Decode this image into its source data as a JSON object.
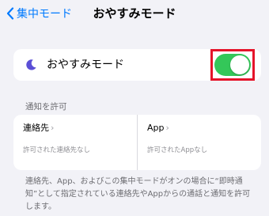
{
  "nav": {
    "back_label": "集中モード",
    "title": "おやすみモード"
  },
  "focus_row": {
    "icon": "moon-icon",
    "label": "おやすみモード",
    "toggle_on": true,
    "toggle_color": "#34c759"
  },
  "allow": {
    "header": "通知を許可",
    "people": {
      "title": "連絡先",
      "subtitle": "許可された連絡先なし"
    },
    "apps": {
      "title": "App",
      "subtitle": "許可されたAppなし"
    }
  },
  "footer": "連絡先、App、およびこの集中モードがオンの場合に“即時通知”として指定されている連絡先やAppからの通話と通知を許可します。",
  "colors": {
    "accent": "#007aff",
    "highlight": "#e5142a",
    "moon": "#5b4fd6",
    "background": "#f2f2f7"
  }
}
